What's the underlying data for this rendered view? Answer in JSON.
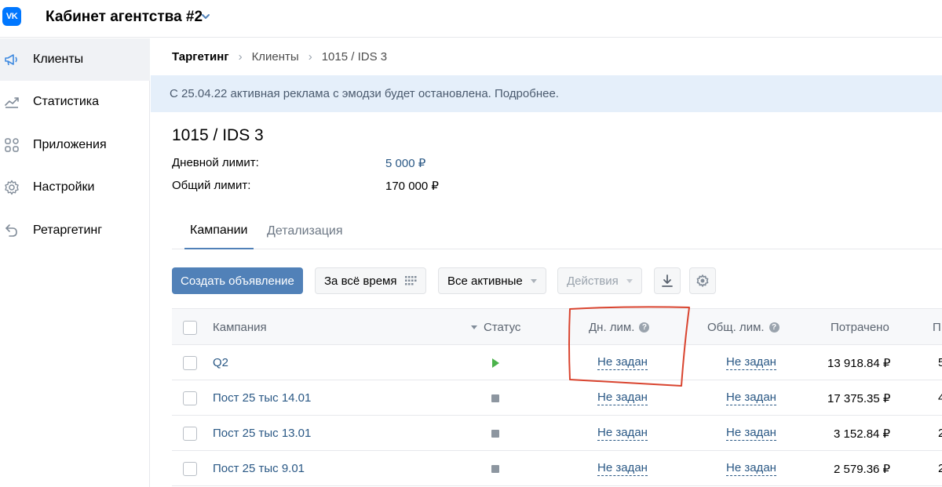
{
  "header": {
    "logo_text": "VK",
    "cabinet_title": "Кабинет агентства #2",
    "accent_color": "#0077ff"
  },
  "sidebar": {
    "items": [
      {
        "label": "Клиенты",
        "icon": "megaphone-icon",
        "active": true
      },
      {
        "label": "Статистика",
        "icon": "chart-line-icon",
        "active": false
      },
      {
        "label": "Приложения",
        "icon": "apps-grid-icon",
        "active": false
      },
      {
        "label": "Настройки",
        "icon": "gear-icon",
        "active": false
      },
      {
        "label": "Ретаргетинг",
        "icon": "retarget-arrow-icon",
        "active": false
      }
    ]
  },
  "breadcrumb": {
    "root": "Таргетинг",
    "items": [
      "Клиенты",
      "1015 / IDS 3"
    ]
  },
  "banner": {
    "text": "С 25.04.22 активная реклама с эмодзи будет остановлена. Подробнее."
  },
  "client": {
    "title": "1015 / IDS 3",
    "daily_limit_label": "Дневной лимит:",
    "daily_limit_value": "5 000 ₽",
    "total_limit_label": "Общий лимит:",
    "total_limit_value": "170 000 ₽"
  },
  "tabs": [
    {
      "label": "Кампании",
      "active": true
    },
    {
      "label": "Детализация",
      "active": false
    }
  ],
  "toolbar": {
    "create_label": "Создать объявление",
    "period_label": "За всё время",
    "filter_label": "Все активные",
    "actions_label": "Действия"
  },
  "table": {
    "columns": {
      "campaign": "Кампания",
      "status": "Статус",
      "daily_limit": "Дн. лим.",
      "total_limit": "Общ. лим.",
      "spent": "Потрачено",
      "next": "П"
    },
    "rows": [
      {
        "name": "Q2",
        "status": "active",
        "daily_limit": "Не задан",
        "total_limit": "Не задан",
        "spent": "13 918.84 ₽",
        "next": "5"
      },
      {
        "name": "Пост 25 тыс 14.01",
        "status": "stopped",
        "daily_limit": "Не задан",
        "total_limit": "Не задан",
        "spent": "17 375.35 ₽",
        "next": "4"
      },
      {
        "name": "Пост 25 тыс 13.01",
        "status": "stopped",
        "daily_limit": "Не задан",
        "total_limit": "Не задан",
        "spent": "3 152.84 ₽",
        "next": "2"
      },
      {
        "name": "Пост 25 тыс 9.01",
        "status": "stopped",
        "daily_limit": "Не задан",
        "total_limit": "Не задан",
        "spent": "2 579.36 ₽",
        "next": "2"
      }
    ]
  },
  "annotation_color": "#d9442f"
}
